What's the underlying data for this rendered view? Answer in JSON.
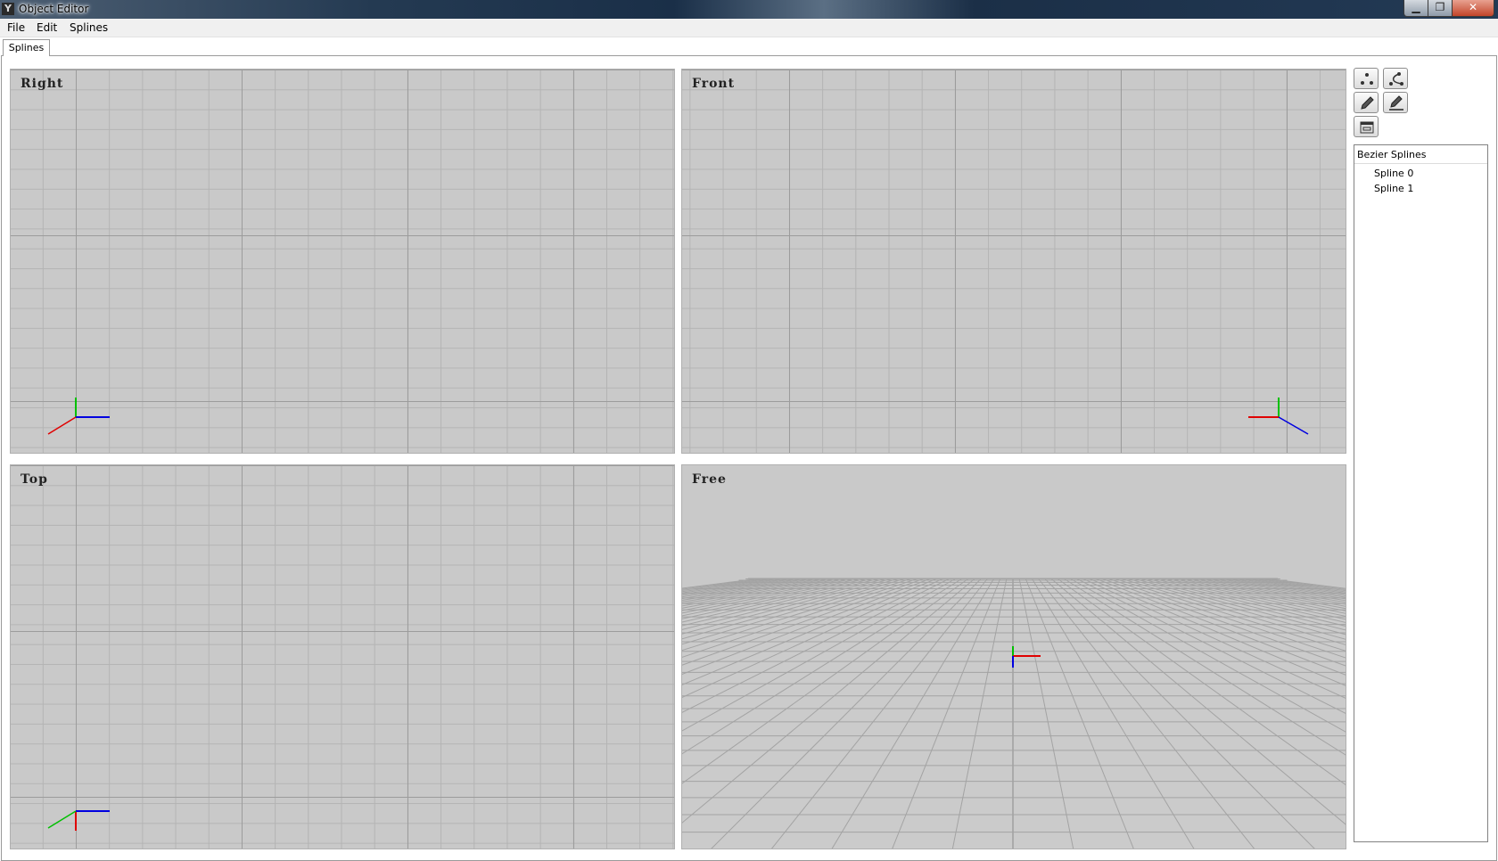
{
  "window": {
    "title": "Object Editor",
    "app_icon": "Y",
    "controls": {
      "minimize": "▁",
      "maximize": "❐",
      "close": "✕"
    }
  },
  "menu": {
    "items": [
      "File",
      "Edit",
      "Splines"
    ]
  },
  "tabs": [
    {
      "label": "Splines",
      "active": true
    }
  ],
  "viewports": {
    "right": {
      "label": "Right"
    },
    "front": {
      "label": "Front"
    },
    "top": {
      "label": "Top"
    },
    "free": {
      "label": "Free"
    }
  },
  "toolbar": {
    "buttons": [
      {
        "icon": "points-icon"
      },
      {
        "icon": "spline-path-icon"
      },
      {
        "icon": "pencil-icon"
      },
      {
        "icon": "pencil-edit-icon"
      },
      {
        "icon": "panel-icon"
      }
    ]
  },
  "tree": {
    "header": "Bezier Splines",
    "items": [
      "Spline 0",
      "Spline 1"
    ]
  },
  "colors": {
    "viewport_bg": "#c9c9c9",
    "grid_major": "#9c9c9c",
    "axis_x": "#e00000",
    "axis_y": "#00c000",
    "axis_z": "#0000e0"
  }
}
